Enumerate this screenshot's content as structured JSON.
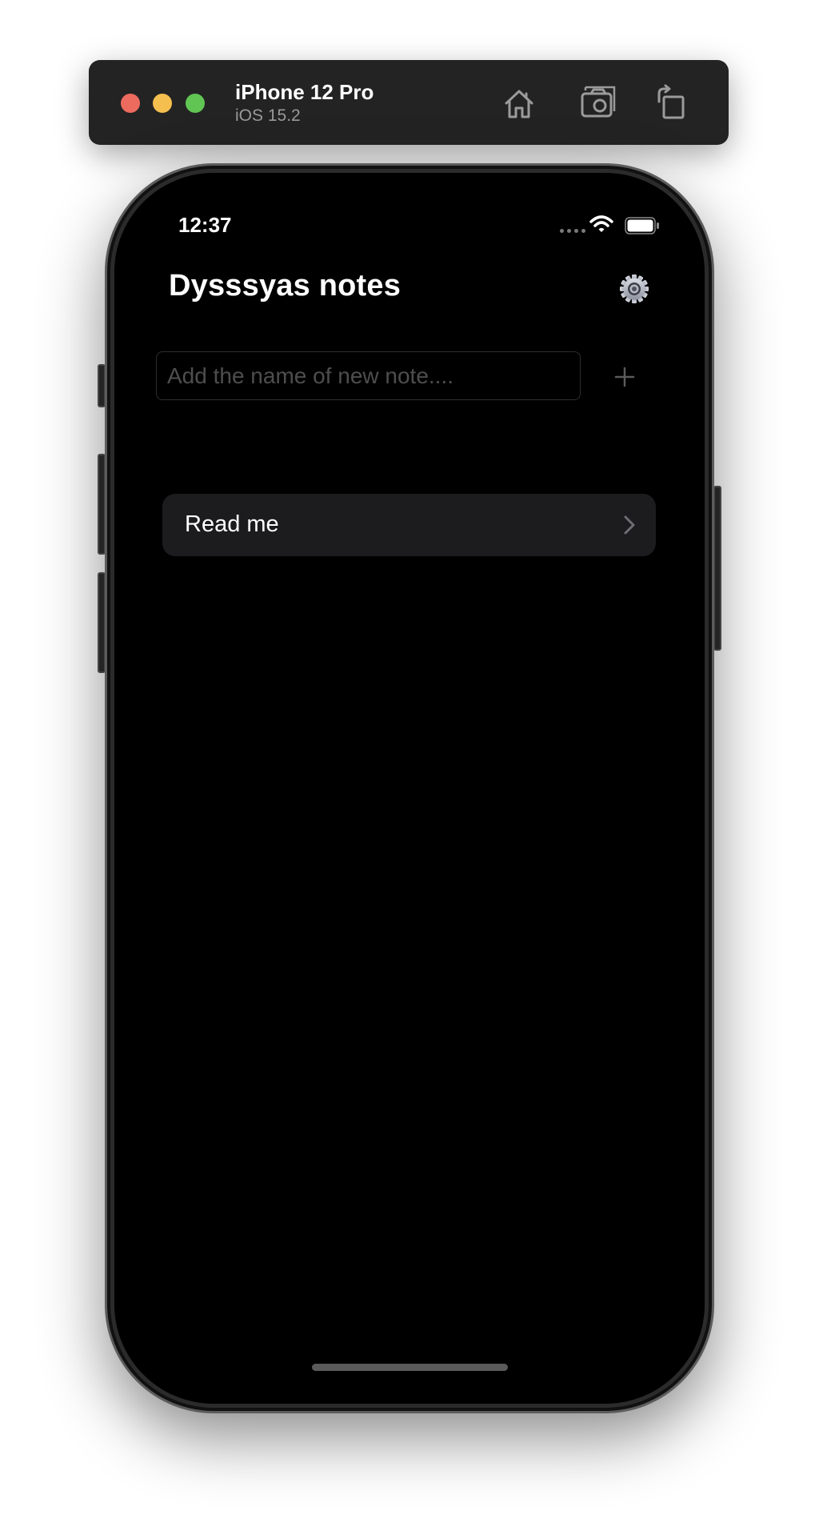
{
  "simulator": {
    "device_name": "iPhone 12 Pro",
    "os_version": "iOS 15.2",
    "toolbar_icons": [
      "home-icon",
      "screenshot-icon",
      "rotate-icon"
    ],
    "traffic_lights": {
      "close": "#ed6a5e",
      "minimize": "#f5bf4f",
      "zoom": "#61c554"
    }
  },
  "status_bar": {
    "time": "12:37",
    "icons": [
      "cellular-signal-icon",
      "wifi-icon",
      "battery-icon"
    ]
  },
  "app": {
    "title": "Dysssyas notes",
    "settings_icon": "gear-icon",
    "new_note_input": {
      "value": "",
      "placeholder": "Add the name of new note...."
    },
    "add_button_icon": "plus-icon",
    "notes": [
      {
        "label": "Read me",
        "icon": "chevron-right-icon"
      }
    ]
  },
  "colors": {
    "screen_background": "#000000",
    "row_background": "#1c1c1e",
    "text_primary": "#ffffff",
    "placeholder": "#4e4e4e"
  }
}
